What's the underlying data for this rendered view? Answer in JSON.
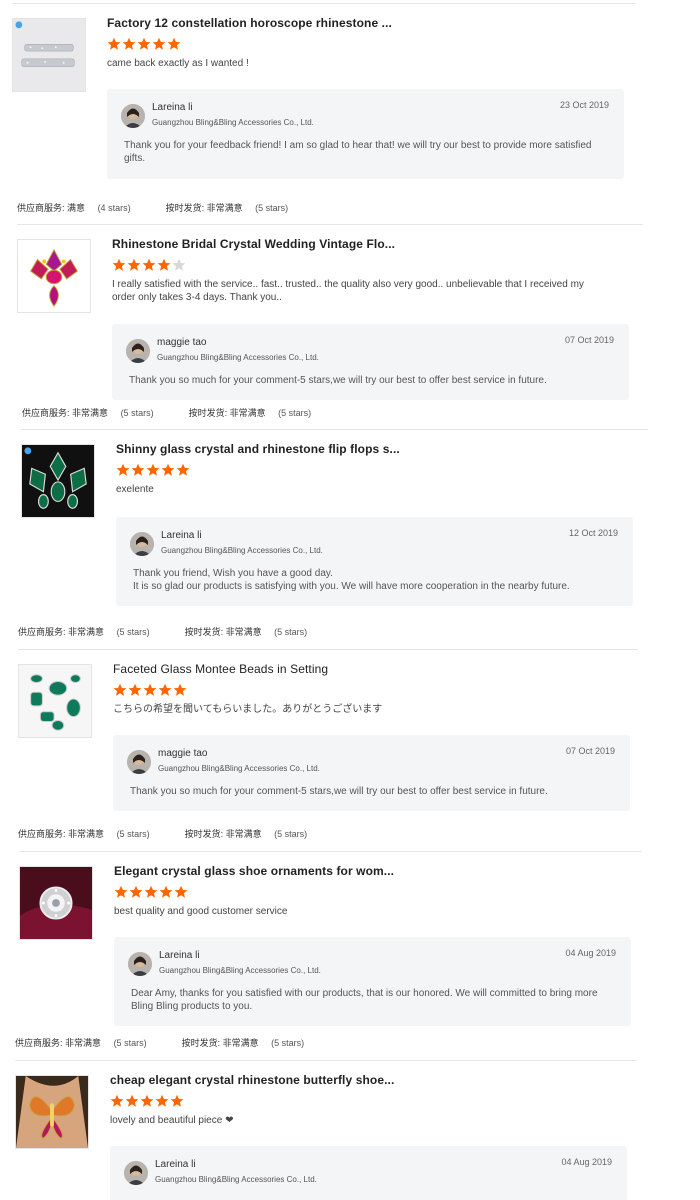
{
  "colors": {
    "star_filled": "#ff6600",
    "star_empty": "#d8d8d8",
    "reply_bg": "#f4f5f7"
  },
  "reviews": [
    {
      "product_title": "Factory 12 constellation horoscope rhinestone ...",
      "rating": 5,
      "thumbnail": "letter-brooch-icon",
      "comment": "came back exactly as I wanted !",
      "reply": {
        "seller_name": "Lareina li",
        "company": "Guangzhou Bling&Bling Accessories Co., Ltd.",
        "date": "23 Oct 2019",
        "text": "Thank you for your feedback friend!  I am so glad to hear that! we will try our best to provide more satisfied gifts."
      },
      "supplier_service": {
        "label": "供应商服务:",
        "value": "满意",
        "count": "(4 stars)"
      },
      "on_time": {
        "label": "按时发货:",
        "value": "非常满意",
        "count": "(5 stars)"
      }
    },
    {
      "product_title": "Rhinestone Bridal Crystal Wedding Vintage Flo...",
      "rating": 4,
      "thumbnail": "brooch-icon",
      "comment": "I really satisfied with the service.. fast.. trusted.. the quality also very good.. unbelievable that I received my order only takes 3-4 days. Thank you..",
      "reply": {
        "seller_name": "maggie tao",
        "company": "Guangzhou Bling&Bling Accessories Co., Ltd.",
        "date": "07 Oct 2019",
        "text": "Thank you so much for your comment-5 stars,we will try our best to offer best service in future."
      },
      "supplier_service": {
        "label": "供应商服务:",
        "value": "非常满意",
        "count": "(5 stars)"
      },
      "on_time": {
        "label": "按时发货:",
        "value": "非常满意",
        "count": "(5 stars)"
      }
    },
    {
      "product_title": "Shinny glass crystal and rhinestone flip flops s...",
      "rating": 5,
      "thumbnail": "green-crystal-icon",
      "comment": "exelente",
      "reply": {
        "seller_name": "Lareina li",
        "company": "Guangzhou Bling&Bling Accessories Co., Ltd.",
        "date": "12 Oct 2019",
        "text": "Thank you friend, Wish you have a good day.\nIt is so glad our products is satisfying with you. We will have more cooperation in the nearby future."
      },
      "supplier_service": {
        "label": "供应商服务:",
        "value": "非常满意",
        "count": "(5 stars)"
      },
      "on_time": {
        "label": "按时发货:",
        "value": "非常满意",
        "count": "(5 stars)"
      }
    },
    {
      "product_title": "Faceted Glass Montee Beads in Setting",
      "rating": 5,
      "thumbnail": "beads-icon",
      "comment": "こちらの希望を聞いてもらいました。ありがとうございます",
      "reply": {
        "seller_name": "maggie tao",
        "company": "Guangzhou Bling&Bling Accessories Co., Ltd.",
        "date": "07 Oct 2019",
        "text": "Thank you so much for your comment-5 stars,we will try our best to offer best service in future."
      },
      "supplier_service": {
        "label": "供应商服务:",
        "value": "非常满意",
        "count": "(5 stars)"
      },
      "on_time": {
        "label": "按时发货:",
        "value": "非常满意",
        "count": "(5 stars)"
      }
    },
    {
      "product_title": "Elegant crystal glass shoe ornaments for wom...",
      "rating": 5,
      "thumbnail": "shoe-ornament-icon",
      "comment": "best quality and good customer service",
      "reply": {
        "seller_name": "Lareina li",
        "company": "Guangzhou Bling&Bling Accessories Co., Ltd.",
        "date": "04 Aug 2019",
        "text": "Dear Amy, thanks for you satisfied with our products, that is our honored. We will committed to bring more Bling Bling products to you."
      },
      "supplier_service": {
        "label": "供应商服务:",
        "value": "非常满意",
        "count": "(5 stars)"
      },
      "on_time": {
        "label": "按时发货:",
        "value": "非常满意",
        "count": "(5 stars)"
      }
    },
    {
      "product_title": "cheap elegant crystal rhinestone butterfly shoe...",
      "rating": 5,
      "thumbnail": "butterfly-icon",
      "comment": "lovely and beautiful piece ❤",
      "reply": {
        "seller_name": "Lareina li",
        "company": "Guangzhou Bling&Bling Accessories Co., Ltd.",
        "date": "04 Aug 2019",
        "text": ""
      },
      "supplier_service": {
        "label": "",
        "value": "",
        "count": ""
      },
      "on_time": {
        "label": "",
        "value": "",
        "count": ""
      }
    }
  ]
}
